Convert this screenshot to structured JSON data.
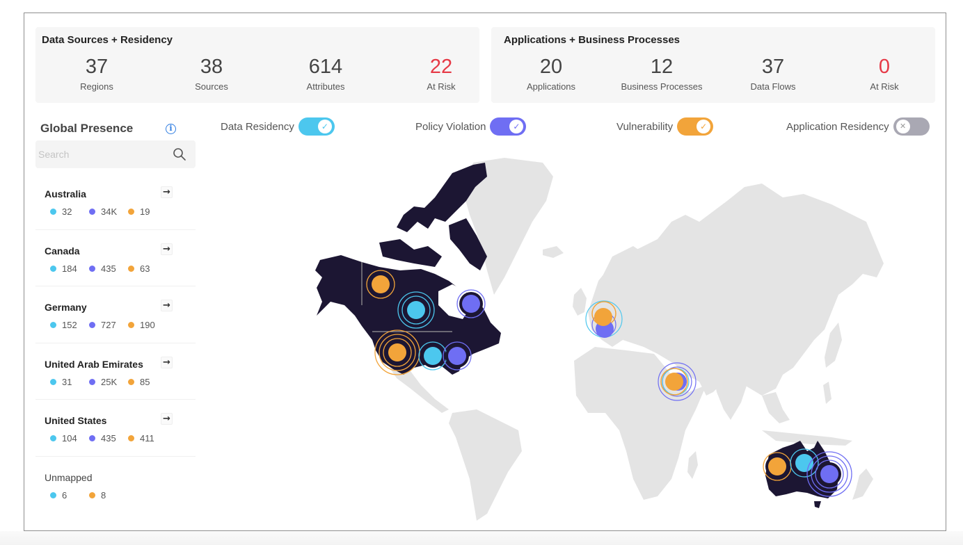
{
  "data_sources": {
    "title": "Data Sources + Residency",
    "stats": [
      {
        "value": "37",
        "label": "Regions",
        "risk": false
      },
      {
        "value": "38",
        "label": "Sources",
        "risk": false
      },
      {
        "value": "614",
        "label": "Attributes",
        "risk": false
      },
      {
        "value": "22",
        "label": "At Risk",
        "risk": true
      }
    ]
  },
  "applications": {
    "title": "Applications + Business Processes",
    "stats": [
      {
        "value": "20",
        "label": "Applications",
        "risk": false
      },
      {
        "value": "12",
        "label": "Business Processes",
        "risk": false
      },
      {
        "value": "37",
        "label": "Data Flows",
        "risk": false
      },
      {
        "value": "0",
        "label": "At Risk",
        "risk": true
      }
    ]
  },
  "global_presence": {
    "title": "Global Presence",
    "info_icon": "info-icon",
    "search": {
      "placeholder": "Search",
      "value": ""
    },
    "countries": [
      {
        "name": "Australia",
        "residency": "32",
        "policy": "34K",
        "vulnerability": "19"
      },
      {
        "name": "Canada",
        "residency": "184",
        "policy": "435",
        "vulnerability": "63"
      },
      {
        "name": "Germany",
        "residency": "152",
        "policy": "727",
        "vulnerability": "190"
      },
      {
        "name": "United Arab Emirates",
        "residency": "31",
        "policy": "25K",
        "vulnerability": "85"
      },
      {
        "name": "United States",
        "residency": "104",
        "policy": "435",
        "vulnerability": "411"
      }
    ],
    "unmapped": {
      "name": "Unmapped",
      "residency": "6",
      "vulnerability": "8"
    }
  },
  "toggles": [
    {
      "label": "Data Residency",
      "on": true,
      "color": "#4cc7ee"
    },
    {
      "label": "Policy Violation",
      "on": true,
      "color": "#6f6ef3"
    },
    {
      "label": "Vulnerability",
      "on": true,
      "color": "#f2a43a"
    },
    {
      "label": "Application Residency",
      "on": false,
      "color": "#a9a8b3"
    }
  ],
  "colors": {
    "residency": "#4cc7ee",
    "policy": "#6f6ef3",
    "vulnerability": "#f2a43a",
    "risk": "#e63946",
    "highlight_land": "#1c1633",
    "land": "#e4e4e4"
  },
  "map": {
    "highlighted_countries": [
      "Canada",
      "United States",
      "Australia"
    ],
    "markers": [
      {
        "region": "Canada-west",
        "type": "vulnerability"
      },
      {
        "region": "Canada-central",
        "type": "residency"
      },
      {
        "region": "Canada-east",
        "type": "policy"
      },
      {
        "region": "US-west",
        "type": "vulnerability"
      },
      {
        "region": "US-central",
        "type": "residency"
      },
      {
        "region": "US-east",
        "type": "policy"
      },
      {
        "region": "Germany",
        "type": "cluster"
      },
      {
        "region": "UAE",
        "type": "cluster"
      },
      {
        "region": "Australia-west",
        "type": "vulnerability"
      },
      {
        "region": "Australia-central",
        "type": "residency"
      },
      {
        "region": "Australia-east",
        "type": "policy"
      }
    ]
  }
}
